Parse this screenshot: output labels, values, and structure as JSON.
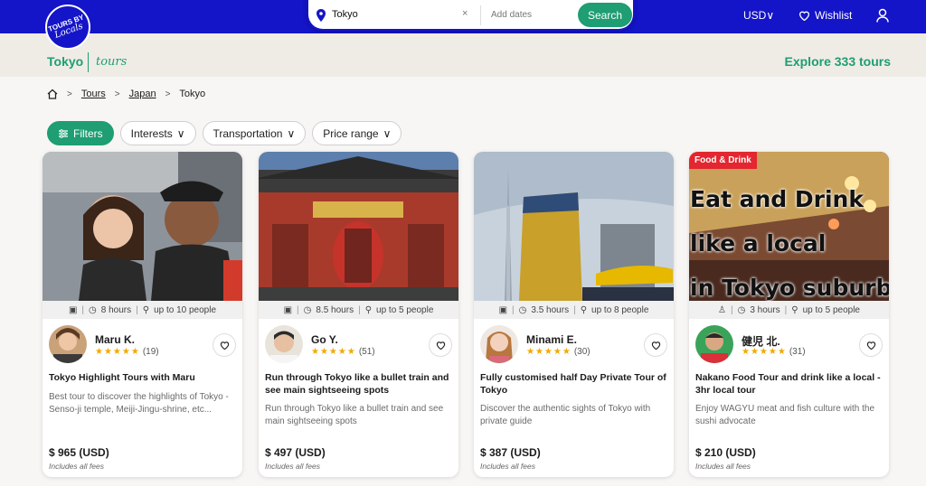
{
  "header": {
    "logo_top": "TOURS BY",
    "logo_bottom": "Locals",
    "search_location": "Tokyo",
    "clear_symbol": "×",
    "dates_placeholder": "Add dates",
    "search_button": "Search",
    "currency": "USD",
    "wishlist": "Wishlist"
  },
  "subheader": {
    "city": "Tokyo",
    "city_tag": "tours",
    "explore": "Explore 333 tours"
  },
  "breadcrumb": [
    "Tours",
    "Japan",
    "Tokyo"
  ],
  "filters": [
    "Filters",
    "Interests",
    "Transportation",
    "Price range"
  ],
  "cards": [
    {
      "duration": "8 hours",
      "group": "up to 10 people",
      "guide": "Maru K.",
      "reviews": "(19)",
      "title": "Tokyo Highlight Tours with Maru",
      "description": "Best tour to discover the highlights of Tokyo - Senso-ji temple, Meiji-Jingu-shrine, etc...",
      "price": "$ 965 (USD)",
      "fees": "Includes all fees"
    },
    {
      "duration": "8.5 hours",
      "group": "up to 5 people",
      "guide": "Go Y.",
      "reviews": "(51)",
      "title": "Run through Tokyo like a bullet train and see main sightseeing spots",
      "description": "Run through Tokyo like a bullet train and see main sightseeing spots",
      "price": "$ 497 (USD)",
      "fees": "Includes all fees"
    },
    {
      "duration": "3.5 hours",
      "group": "up to 8 people",
      "guide": "Minami E.",
      "reviews": "(30)",
      "title": "Fully customised half Day Private Tour of Tokyo",
      "description": "Discover the authentic sights of Tokyo with private guide",
      "price": "$ 387 (USD)",
      "fees": "Includes all fees"
    },
    {
      "duration": "3 hours",
      "group": "up to 5 people",
      "guide": "健児 北.",
      "reviews": "(31)",
      "title": "Nakano Food Tour and drink like a local - 3hr local tour",
      "description": "Enjoy WAGYU meat and fish culture with the sushi advocate",
      "price": "$ 210 (USD)",
      "fees": "Includes all fees",
      "image_tag": "Food & Drink",
      "image_text": [
        "Eat and Drink",
        "like a local",
        "in Tokyo suburbia"
      ]
    }
  ],
  "stars": "★★★★★",
  "colors": {
    "brand_blue": "#1414c8",
    "accent_green": "#1e9e72",
    "star": "#f0a900"
  }
}
